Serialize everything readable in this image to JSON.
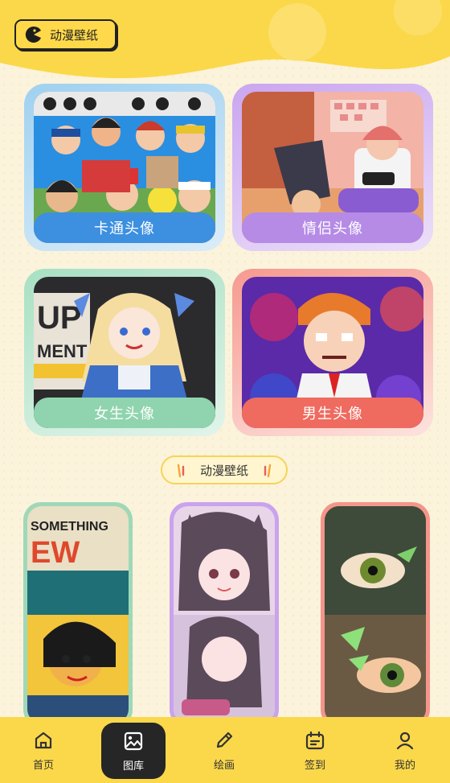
{
  "header": {
    "title": "动漫壁纸",
    "logo_icon": "pacman-icon"
  },
  "categories": [
    {
      "label": "卡通头像",
      "color": "#3d8fe0"
    },
    {
      "label": "情侣头像",
      "color": "#b58be6"
    },
    {
      "label": "女生头像",
      "color": "#8fd4ae"
    },
    {
      "label": "男生头像",
      "color": "#ef6a5f"
    }
  ],
  "section": {
    "title": "动漫壁纸"
  },
  "tabs": [
    {
      "label": "首页",
      "icon": "home-icon"
    },
    {
      "label": "图库",
      "icon": "gallery-icon",
      "active": true
    },
    {
      "label": "绘画",
      "icon": "pencil-icon"
    },
    {
      "label": "签到",
      "icon": "calendar-icon"
    },
    {
      "label": "我的",
      "icon": "user-icon"
    }
  ]
}
